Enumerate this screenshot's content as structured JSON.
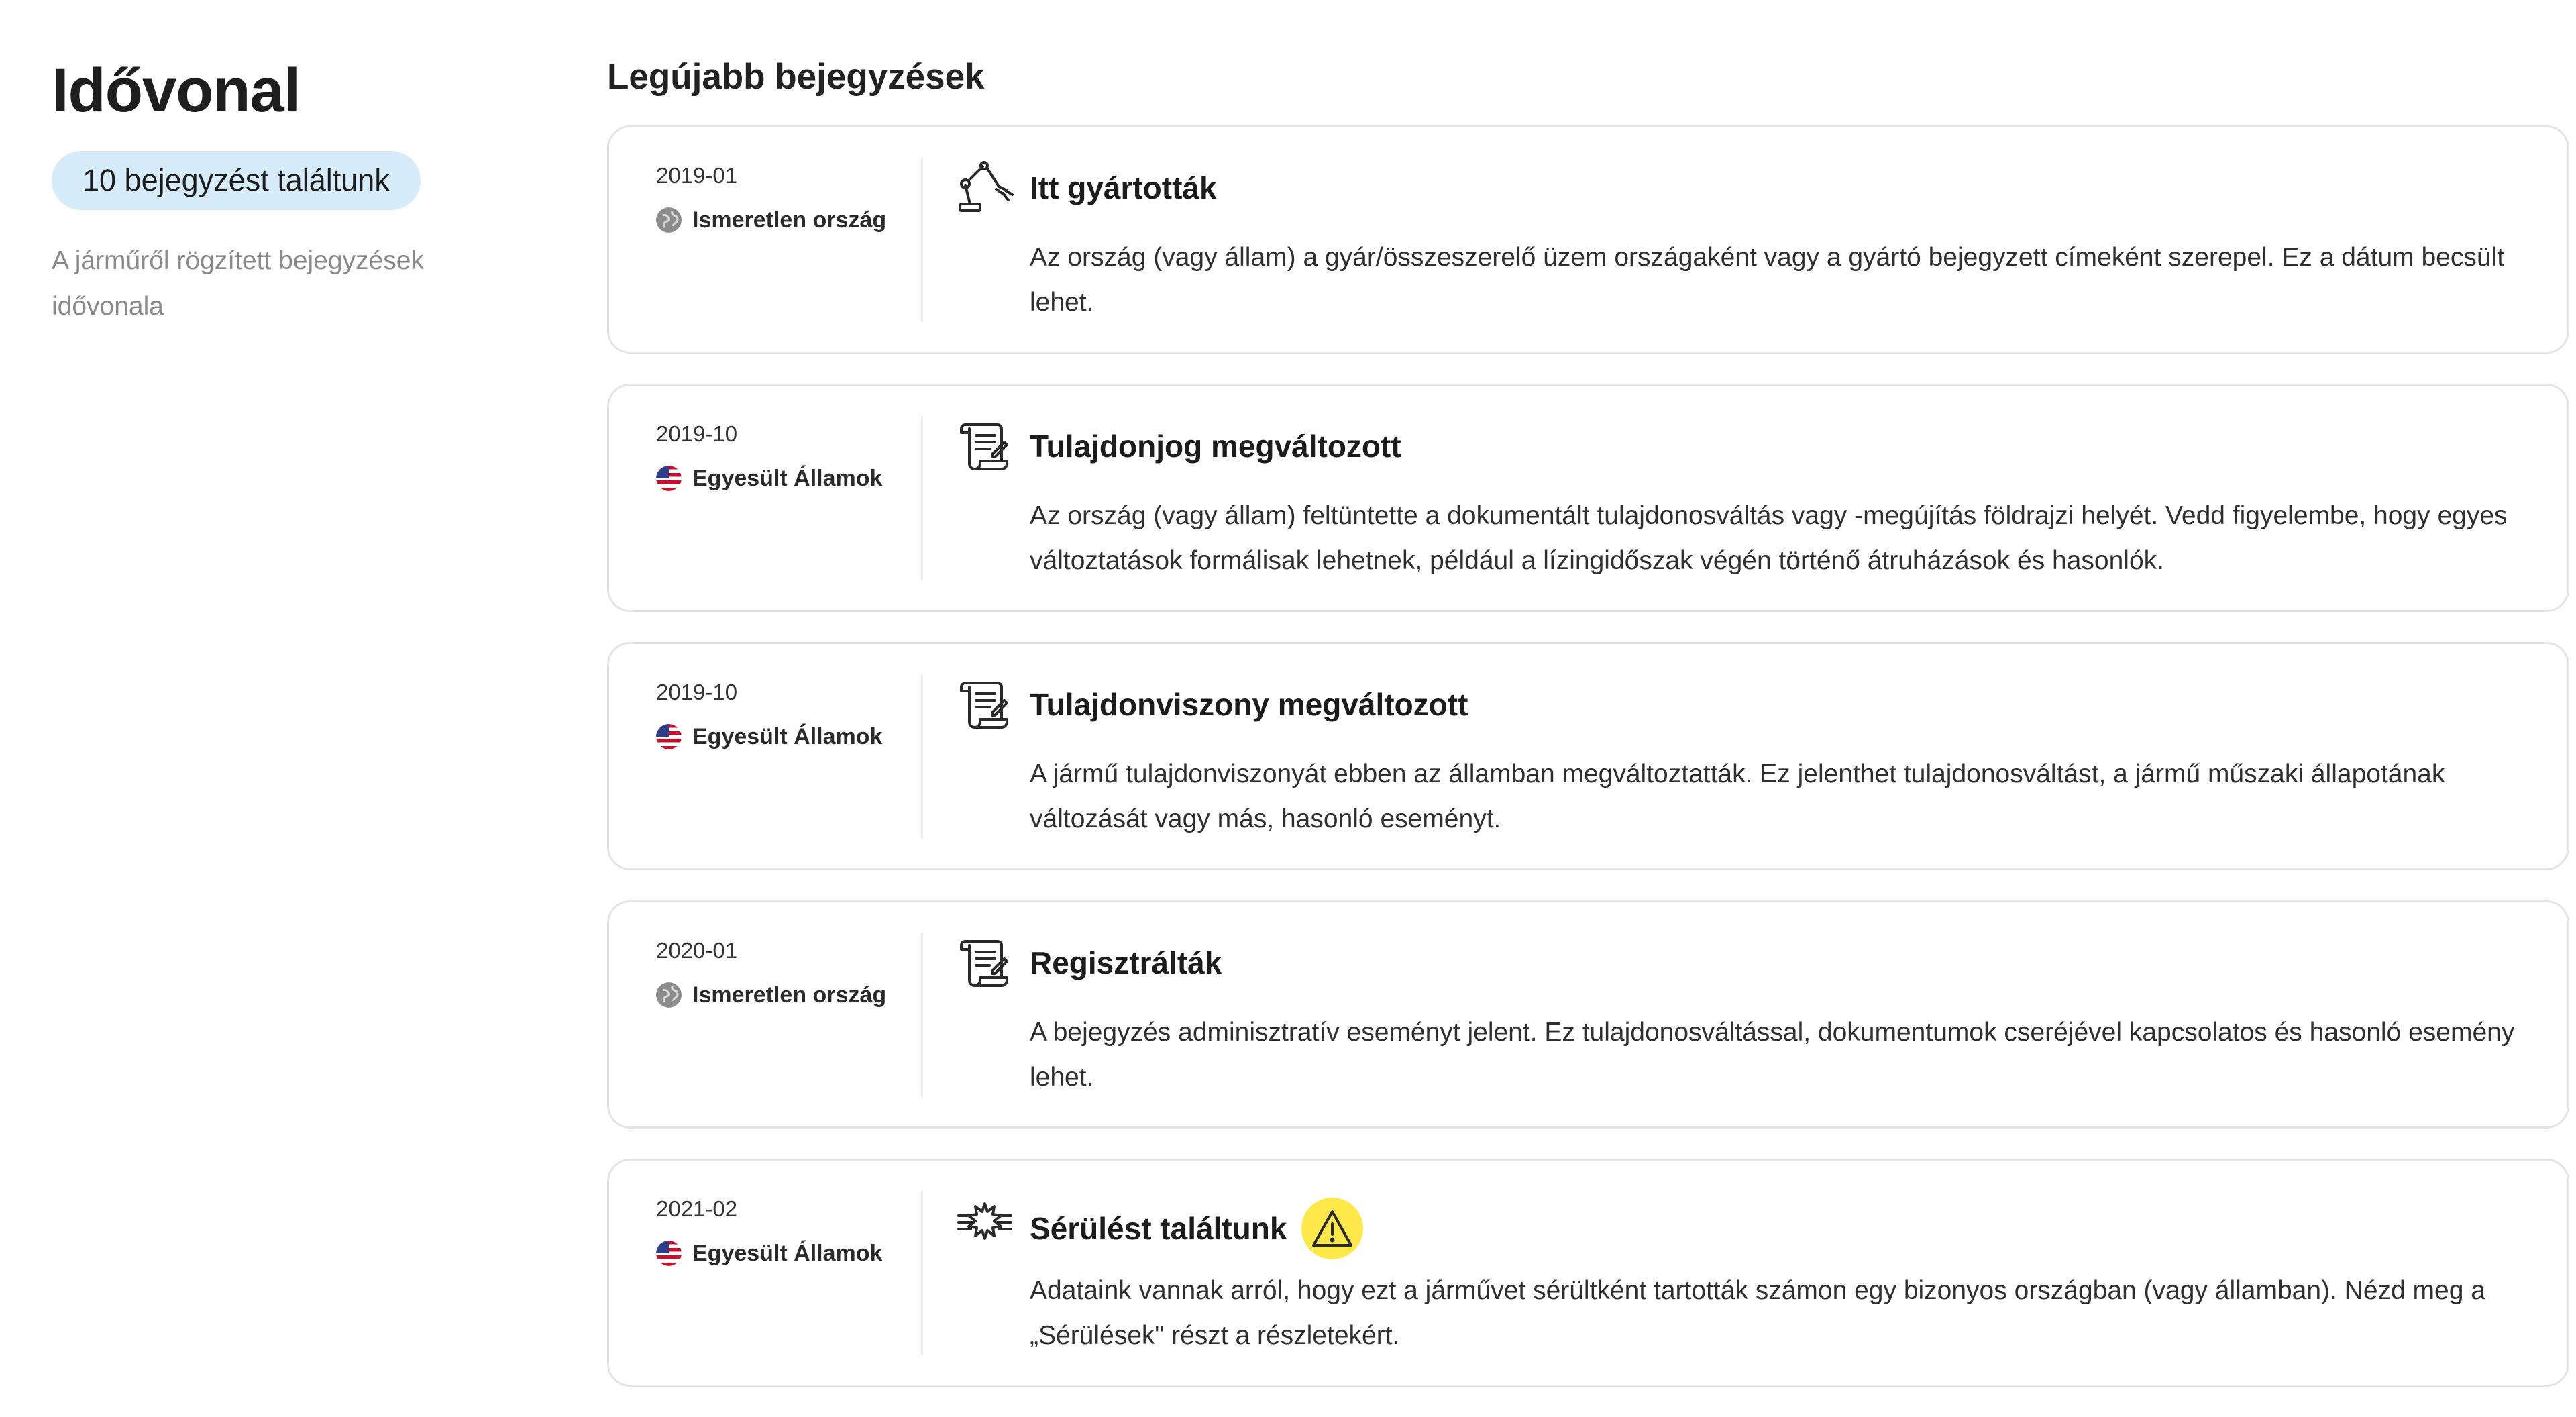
{
  "sidebar": {
    "title": "Idővonal",
    "count_label": "10 bejegyzést találtunk",
    "description": "A járműről rögzített bejegyzések idővonala"
  },
  "main": {
    "section_title": "Legújabb bejegyzések",
    "entries": [
      {
        "date": "2019-01",
        "country": "Ismeretlen ország",
        "flag_icon": "globe-icon",
        "event_icon": "robot-arm-icon",
        "title": "Itt gyártották",
        "body": "Az ország (vagy állam) a gyár/összeszerelő üzem országaként vagy a gyártó bejegyzett címeként szerepel. Ez a dátum becsült lehet."
      },
      {
        "date": "2019-10",
        "country": "Egyesült Államok",
        "flag_icon": "us-flag-icon",
        "event_icon": "document-scroll-icon",
        "title": "Tulajdonjog megváltozott",
        "body": "Az ország (vagy állam) feltüntette a dokumentált tulajdonosváltás vagy -megújítás földrajzi helyét. Vedd figyelembe, hogy egyes változtatások formálisak lehetnek, például a lízingidőszak végén történő átruházások és hasonlók."
      },
      {
        "date": "2019-10",
        "country": "Egyesült Államok",
        "flag_icon": "us-flag-icon",
        "event_icon": "document-scroll-icon",
        "title": "Tulajdonviszony megváltozott",
        "body": "A jármű tulajdonviszonyát ebben az államban megváltoztatták. Ez jelenthet tulajdonosváltást, a jármű műszaki állapotának változását vagy más, hasonló eseményt."
      },
      {
        "date": "2020-01",
        "country": "Ismeretlen ország",
        "flag_icon": "globe-icon",
        "event_icon": "document-scroll-icon",
        "title": "Regisztrálták",
        "body": "A bejegyzés adminisztratív eseményt jelent. Ez tulajdonosváltással, dokumentumok cseréjével kapcsolatos és hasonló esemény lehet."
      },
      {
        "date": "2021-02",
        "country": "Egyesült Államok",
        "flag_icon": "us-flag-icon",
        "event_icon": "crash-icon",
        "title": "Sérülést találtunk",
        "warning": true,
        "body": "Adataink vannak arról, hogy ezt a járművet sérültként tartották számon egy bizonyos országban (vagy államban). Nézd meg a „Sérülések\" részt a részletekért."
      }
    ]
  },
  "colors": {
    "pill_background": "#d6ecfa",
    "card_border": "#e4e4e4",
    "warning": "#ffe94a",
    "muted_text": "#8a8a8a"
  }
}
